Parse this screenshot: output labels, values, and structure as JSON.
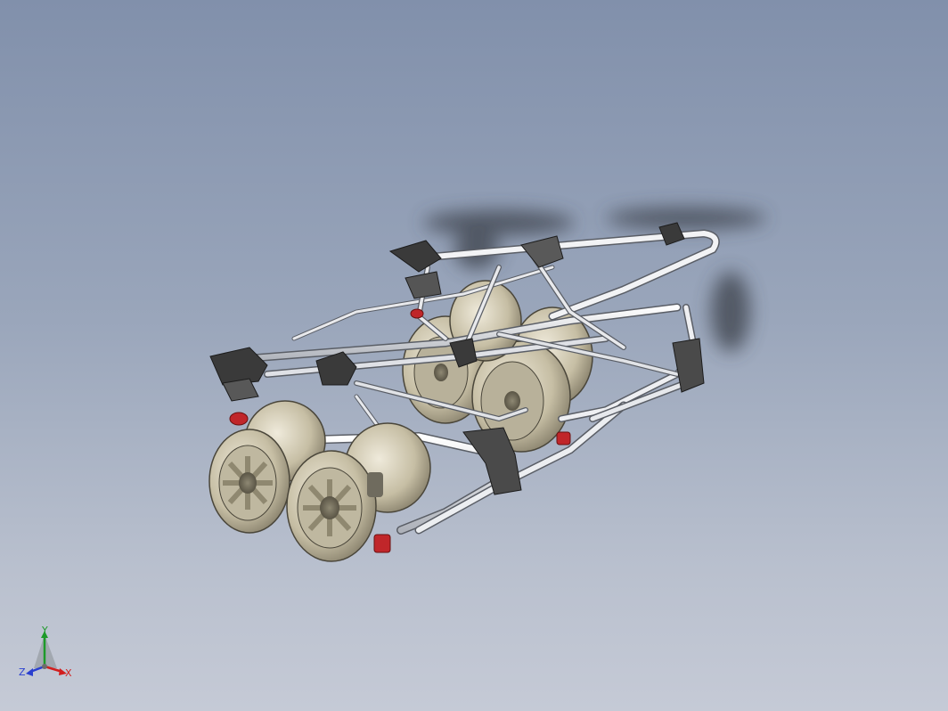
{
  "viewport": {
    "background_top": "#8190ab",
    "background_bottom": "#c5cad6"
  },
  "model": {
    "description_icon": "stroller-frame-3d-model",
    "frame_color": "#e4e6ea",
    "wheel_color": "#c8c2a8",
    "plastic_color": "#3a3a3a",
    "accent_color": "#c0262a"
  },
  "triad": {
    "x_label": "X",
    "y_label": "Y",
    "z_label": "Z",
    "x_color": "#d21e1e",
    "y_color": "#1e9a2a",
    "z_color": "#2a3fcf"
  }
}
